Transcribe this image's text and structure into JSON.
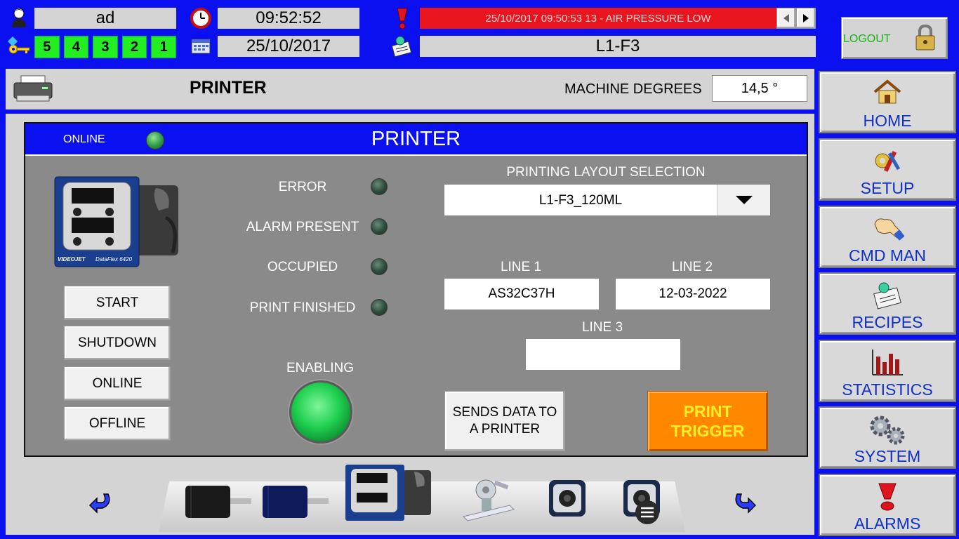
{
  "header": {
    "user": "ad",
    "time": "09:52:52",
    "date": "25/10/2017",
    "access_levels": [
      "5",
      "4",
      "3",
      "2",
      "1"
    ],
    "alarm_message": "25/10/2017 09:50:53 13 - AIR PRESSURE LOW",
    "recipe": "L1-F3",
    "logout_label": "LOGOUT"
  },
  "title_bar": {
    "page_title": "PRINTER",
    "degrees_label": "MACHINE DEGREES",
    "degrees_value": "14,5 °"
  },
  "panel": {
    "title": "PRINTER",
    "online_label": "ONLINE",
    "printer_brand": "VIDEOJET",
    "printer_model": "DataFlex 6420",
    "status_labels": {
      "error": "ERROR",
      "alarm_present": "ALARM PRESENT",
      "occupied": "OCCUPIED",
      "print_finished": "PRINT FINISHED",
      "enabling": "ENABLING"
    },
    "buttons": {
      "start": "START",
      "shutdown": "SHUTDOWN",
      "online": "ONLINE",
      "offline": "OFFLINE",
      "send_data": "SENDS DATA TO A PRINTER",
      "print_trigger": "PRINT TRIGGER"
    },
    "layout_selection_label": "PRINTING LAYOUT SELECTION",
    "layout_selected": "L1-F3_120ML",
    "line1_label": "LINE 1",
    "line1_value": "AS32C37H",
    "line2_label": "LINE 2",
    "line2_value": "12-03-2022",
    "line3_label": "LINE 3",
    "line3_value": ""
  },
  "nav": {
    "home": "HOME",
    "setup": "SETUP",
    "cmd_man": "CMD MAN",
    "recipes": "RECIPES",
    "statistics": "STATISTICS",
    "system": "SYSTEM",
    "alarms": "ALARMS"
  },
  "colors": {
    "background": "#0b10f0",
    "alarm_bar": "#e8141e",
    "access_level": "#22ee22",
    "print_trigger": "#ff8800",
    "nav_text": "#1030c8"
  }
}
